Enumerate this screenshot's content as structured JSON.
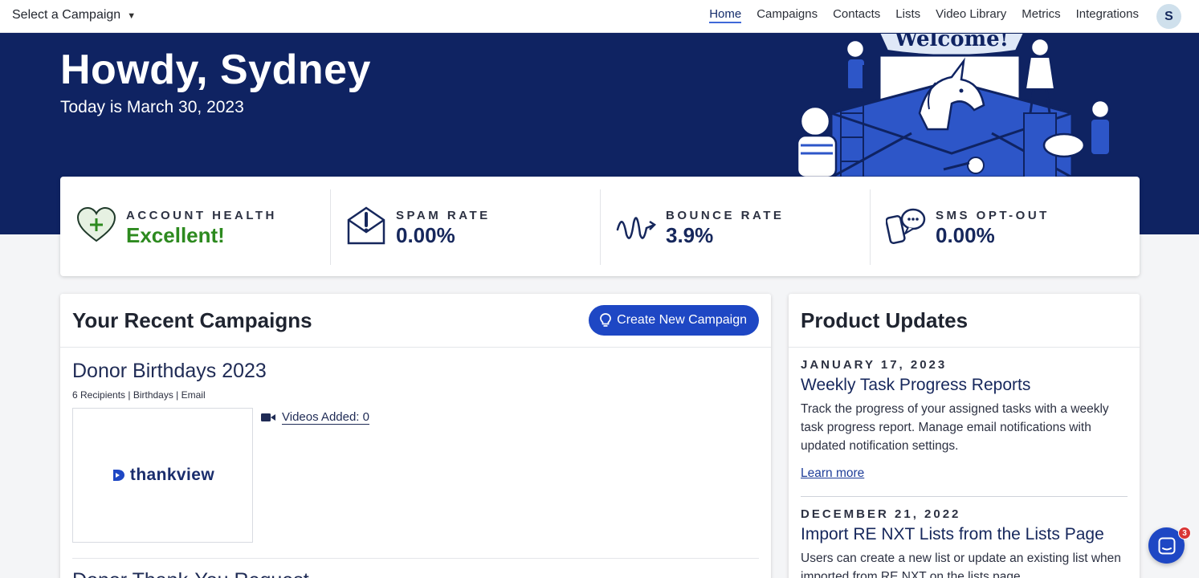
{
  "topbar": {
    "campaign_select": "Select a Campaign",
    "nav": [
      "Home",
      "Campaigns",
      "Contacts",
      "Lists",
      "Video Library",
      "Metrics",
      "Integrations"
    ],
    "avatar_initial": "S"
  },
  "hero": {
    "greeting": "Howdy, Sydney",
    "date_line": "Today is March 30, 2023",
    "illustration_text": "Welcome!"
  },
  "stats": [
    {
      "label": "ACCOUNT HEALTH",
      "value": "Excellent!",
      "icon": "heart-plus-icon"
    },
    {
      "label": "SPAM RATE",
      "value": "0.00%",
      "icon": "envelope-alert-icon"
    },
    {
      "label": "BOUNCE RATE",
      "value": "3.9%",
      "icon": "bounce-line-icon"
    },
    {
      "label": "SMS OPT-OUT",
      "value": "0.00%",
      "icon": "phone-chat-icon"
    }
  ],
  "colors": {
    "navy": "#0f2362",
    "accent": "#1e47c4",
    "health_green": "#2d8a1f"
  },
  "campaigns": {
    "title": "Your Recent Campaigns",
    "create_button": "Create New Campaign",
    "items": [
      {
        "name": "Donor Birthdays 2023",
        "meta": "6 Recipients | Birthdays | Email",
        "thumb_logo": "thankview",
        "videos_added": "Videos Added: 0"
      },
      {
        "name": "Donor Thank-You Request"
      }
    ]
  },
  "updates": {
    "title": "Product Updates",
    "items": [
      {
        "date": "JANUARY 17, 2023",
        "title": "Weekly Task Progress Reports",
        "body": "Track the progress of your assigned tasks with a weekly task progress report. Manage email notifications with updated notification settings.",
        "link": "Learn more"
      },
      {
        "date": "DECEMBER 21, 2022",
        "title": "Import RE NXT Lists from the Lists Page",
        "body": "Users can create a new list or update an existing list when imported from RE NXT on the lists page."
      }
    ]
  },
  "chat": {
    "badge_count": "3"
  }
}
